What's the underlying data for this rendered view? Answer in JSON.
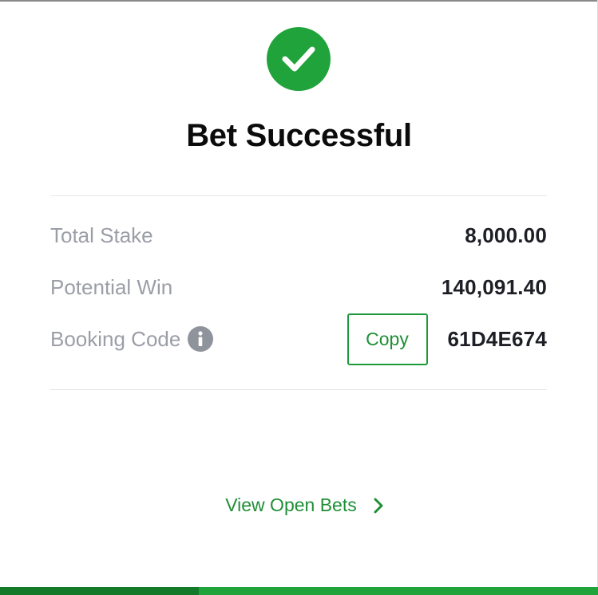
{
  "title": "Bet Successful",
  "summary": {
    "total_stake_label": "Total Stake",
    "total_stake_value": "8,000.00",
    "potential_win_label": "Potential Win",
    "potential_win_value": "140,091.40",
    "booking_code_label": "Booking Code",
    "booking_code_value": "61D4E674",
    "copy_label": "Copy"
  },
  "footer": {
    "view_open_bets_label": "View Open Bets"
  },
  "icons": {
    "success": "check-circle-icon",
    "info": "info-icon",
    "chevron": "chevron-right-icon"
  },
  "colors": {
    "accent_green": "#1fa33a",
    "text_green": "#1f8f37",
    "label_gray": "#9b9ea6",
    "value_dark": "#1e1f25"
  }
}
